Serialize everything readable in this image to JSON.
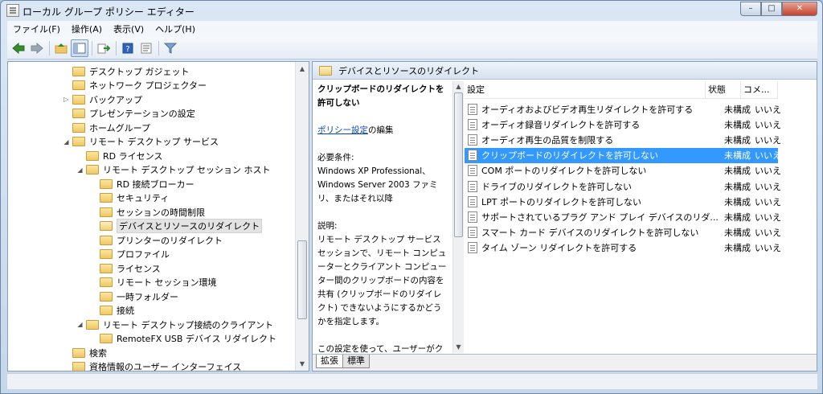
{
  "window": {
    "title": "ローカル グループ ポリシー エディター",
    "minimize": "–",
    "maximize": "□",
    "close": "✕"
  },
  "menu": [
    "ファイル(F)",
    "操作(A)",
    "表示(V)",
    "ヘルプ(H)"
  ],
  "toolbar": {
    "icons": [
      "back-icon",
      "forward-icon",
      "up-folder-icon",
      "show-tree-icon",
      "export-icon",
      "help-icon",
      "properties-icon",
      "filter-icon"
    ]
  },
  "tree": [
    {
      "label": "デスクトップ ガジェット",
      "expander": ""
    },
    {
      "label": "ネットワーク プロジェクター",
      "expander": ""
    },
    {
      "label": "バックアップ",
      "expander": "▷"
    },
    {
      "label": "プレゼンテーションの設定",
      "expander": ""
    },
    {
      "label": "ホームグループ",
      "expander": ""
    },
    {
      "label": "リモート デスクトップ サービス",
      "expander": "◢"
    },
    {
      "label": "RD ライセンス",
      "expander": ""
    },
    {
      "label": "リモート デスクトップ セッション ホスト",
      "expander": "◢"
    },
    {
      "label": "RD 接続ブローカー",
      "expander": ""
    },
    {
      "label": "セキュリティ",
      "expander": ""
    },
    {
      "label": "セッションの時間制限",
      "expander": ""
    },
    {
      "label": "デバイスとリソースのリダイレクト",
      "expander": ""
    },
    {
      "label": "プリンターのリダイレクト",
      "expander": ""
    },
    {
      "label": "プロファイル",
      "expander": ""
    },
    {
      "label": "ライセンス",
      "expander": ""
    },
    {
      "label": "リモート セッション環境",
      "expander": ""
    },
    {
      "label": "一時フォルダー",
      "expander": ""
    },
    {
      "label": "接続",
      "expander": ""
    },
    {
      "label": "リモート デスクトップ接続のクライアント",
      "expander": "◢"
    },
    {
      "label": "RemoteFX USB デバイス リダイレクト",
      "expander": ""
    },
    {
      "label": "検索",
      "expander": ""
    },
    {
      "label": "資格情報のユーザー インターフェイス",
      "expander": ""
    }
  ],
  "right_header": "デバイスとリソースのリダイレクト",
  "description": {
    "title": "クリップボードのリダイレクトを許可しない",
    "link": "ポリシー設定",
    "link_suffix": "の編集",
    "requirements_label": "必要条件:",
    "requirements": "Windows XP Professional、Windows Server 2003 ファミリ、またはそれ以降",
    "explain_label": "説明:",
    "explain": "リモート デスクトップ サービス セッションで、リモート コンピューターとクライアント コンピューター間のクリップボードの内容を共有 (クリップボードのリダイレクト) できないようにするかどうかを指定します。",
    "explain2": "この設定を使って、ユーザーがクリップボードのデータをリモート"
  },
  "list": {
    "headers": [
      "設定",
      "状態",
      "コメ..."
    ],
    "rows": [
      {
        "name": "オーディオおよびビデオ再生リダイレクトを許可する",
        "state": "未構成",
        "comment": "いいえ"
      },
      {
        "name": "オーディオ録音リダイレクトを許可する",
        "state": "未構成",
        "comment": "いいえ"
      },
      {
        "name": "オーディオ再生の品質を制限する",
        "state": "未構成",
        "comment": "いいえ"
      },
      {
        "name": "クリップボードのリダイレクトを許可しない",
        "state": "未構成",
        "comment": "いいえ"
      },
      {
        "name": "COM ポートのリダイレクトを許可しない",
        "state": "未構成",
        "comment": "いいえ"
      },
      {
        "name": "ドライブのリダイレクトを許可しない",
        "state": "未構成",
        "comment": "いいえ"
      },
      {
        "name": "LPT ポートのリダイレクトを許可しない",
        "state": "未構成",
        "comment": "いいえ"
      },
      {
        "name": "サポートされているプラグ アンド プレイ デバイスのリダ...",
        "state": "未構成",
        "comment": "いいえ"
      },
      {
        "name": "スマート カード デバイスのリダイレクトを許可しない",
        "state": "未構成",
        "comment": "いいえ"
      },
      {
        "name": "タイム ゾーン リダイレクトを許可する",
        "state": "未構成",
        "comment": "いいえ"
      }
    ]
  },
  "tabs": [
    "拡張",
    "標準"
  ],
  "colors": {
    "selection": "#3399ff",
    "link": "#0645ad",
    "folder": "#efc765"
  }
}
